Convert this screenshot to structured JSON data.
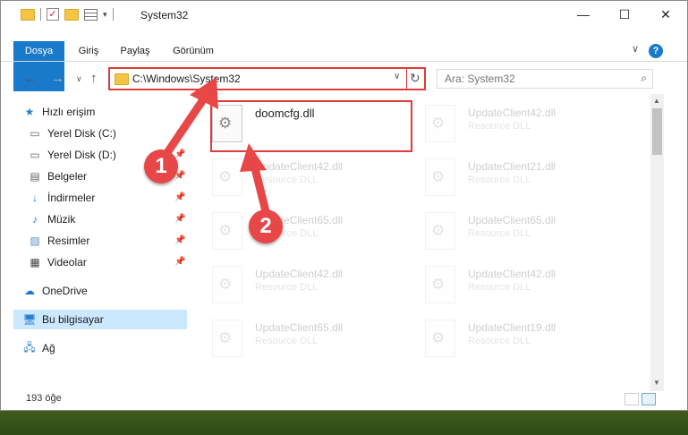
{
  "window": {
    "title": "System32",
    "controls": {
      "minimize": "—",
      "maximize": "☐",
      "close": "✕"
    }
  },
  "ribbon": {
    "tabs": [
      "Dosya",
      "Giriş",
      "Paylaş",
      "Görünüm"
    ],
    "help": "?"
  },
  "address": {
    "path": "C:\\Windows\\System32",
    "search_placeholder": "Ara: System32"
  },
  "nav": {
    "items": [
      {
        "label": "Hızlı erişim",
        "icon": "star-icon",
        "pinned": false
      },
      {
        "label": "Yerel Disk (C:)",
        "icon": "drive-icon",
        "pinned": true
      },
      {
        "label": "Yerel Disk (D:)",
        "icon": "drive-icon",
        "pinned": true
      },
      {
        "label": "Belgeler",
        "icon": "documents-icon",
        "pinned": true
      },
      {
        "label": "İndirmeler",
        "icon": "download-icon",
        "pinned": true
      },
      {
        "label": "Müzik",
        "icon": "music-icon",
        "pinned": true
      },
      {
        "label": "Resimler",
        "icon": "pictures-icon",
        "pinned": true
      },
      {
        "label": "Videolar",
        "icon": "videos-icon",
        "pinned": true
      },
      {
        "label": "OneDrive",
        "icon": "cloud-icon",
        "pinned": false
      },
      {
        "label": "Bu bilgisayar",
        "icon": "computer-icon",
        "pinned": false,
        "selected": true
      },
      {
        "label": "Ağ",
        "icon": "network-icon",
        "pinned": false
      }
    ]
  },
  "files": {
    "highlighted": {
      "name": "doomcfg.dll",
      "type": ""
    },
    "background": [
      {
        "name": "UpdateClient42.dll",
        "type": "Resource DLL"
      },
      {
        "name": "UpdateClient42.dll",
        "type": "Resource DLL"
      },
      {
        "name": "UpdateClient21.dll",
        "type": "Resource DLL"
      },
      {
        "name": "UpdateClient65.dll",
        "type": "Resource DLL"
      },
      {
        "name": "UpdateClient65.dll",
        "type": "Resource DLL"
      },
      {
        "name": "UpdateClient42.dll",
        "type": "Resource DLL"
      },
      {
        "name": "UpdateClient42.dll",
        "type": "Resource DLL"
      },
      {
        "name": "UpdateClient65.dll",
        "type": "Resource DLL"
      },
      {
        "name": "UpdateClient19.dll",
        "type": "Resource DLL"
      }
    ]
  },
  "status": {
    "count": "193 öğe"
  },
  "annotations": {
    "step1": "1",
    "step2": "2"
  },
  "colors": {
    "accent": "#1979ca",
    "highlight": "#e23a3a",
    "marker": "#e84747"
  }
}
